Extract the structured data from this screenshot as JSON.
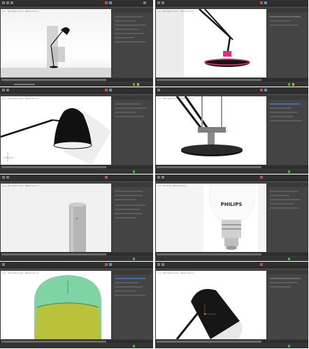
{
  "app": {
    "name": "3D modeling application",
    "layout": "4 rows x 2 columns grid of viewport screenshots"
  },
  "panels": [
    {
      "id": "p1",
      "subject": "desk lamp full view",
      "viewport_label": "[+] [Perspective] [Realistic]"
    },
    {
      "id": "p2",
      "subject": "lamp base and arms",
      "viewport_label": "[+] [Perspective] [Realistic]"
    },
    {
      "id": "p3",
      "subject": "lamp shade close-up",
      "viewport_label": "[+] [Perspective] [Realistic]"
    },
    {
      "id": "p4",
      "subject": "lamp base close-up",
      "viewport_label": "[+] [Perspective] [Realistic]"
    },
    {
      "id": "p5",
      "subject": "cylinder primitive",
      "viewport_label": "[+] [Perspective] [Realistic]"
    },
    {
      "id": "p6",
      "subject": "light bulb reference image",
      "viewport_label": "[+] [Front] [Realistic]",
      "bulb_brand": "PHILIPS"
    },
    {
      "id": "p7",
      "subject": "light bulb modeling",
      "viewport_label": "[+] [Perspective] [Realistic]"
    },
    {
      "id": "p8",
      "subject": "lamp head detail",
      "viewport_label": "[+] [Perspective] [Realistic]"
    }
  ],
  "colors": {
    "ui_dark": "#3b3b3b",
    "panel_bg": "#444444",
    "accent_green": "#4fa24f",
    "lamp_black": "#151515",
    "lamp_pink": "#e0307a",
    "bulb_green": "#7fd4a6",
    "bulb_olive": "#b8c23a"
  },
  "icons": [
    "toolbar-icon",
    "play-icon",
    "key-icon",
    "move-icon"
  ]
}
